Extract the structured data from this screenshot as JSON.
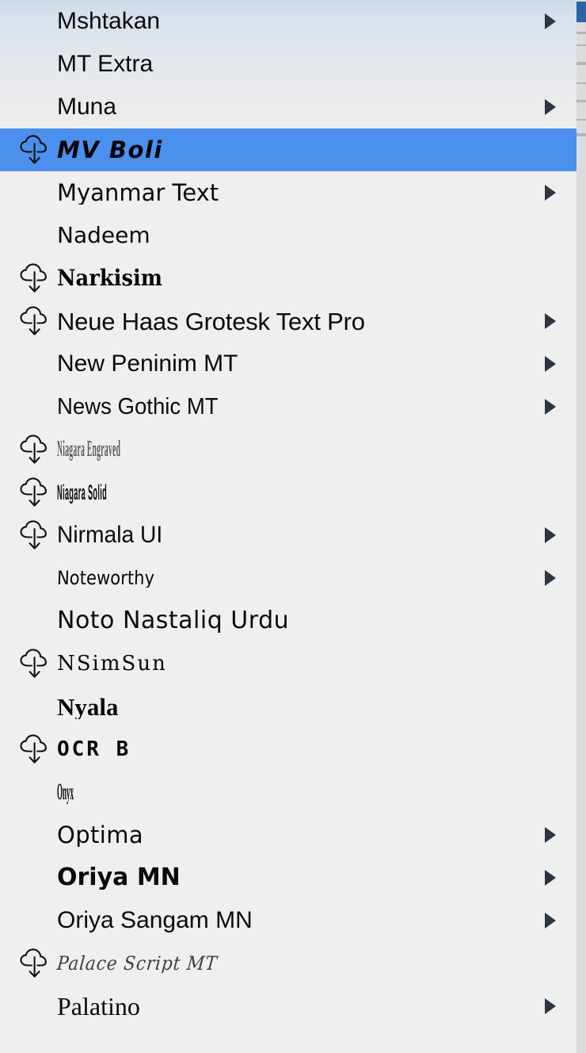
{
  "menu": {
    "kind": "font-family-picker-dropdown",
    "selected_item": "MV Boli",
    "colors": {
      "selection_blue": "#4a90ec",
      "panel_background": "#efefef",
      "panel_gradient_top": "#ccd9e8",
      "arrow": "#2d3541",
      "label_text": "#0a0a0a"
    },
    "items": [
      {
        "label": "Mshtakan",
        "style": "fs-sans",
        "downloadable": false,
        "has_submenu": true,
        "selected": false
      },
      {
        "label": "MT Extra",
        "style": "fs-sans",
        "downloadable": false,
        "has_submenu": false,
        "selected": false
      },
      {
        "label": "Muna",
        "style": "fs-muna",
        "downloadable": false,
        "has_submenu": true,
        "selected": false
      },
      {
        "label": "MV Boli",
        "style": "fs-mvboli",
        "downloadable": true,
        "has_submenu": false,
        "selected": true
      },
      {
        "label": "Myanmar Text",
        "style": "fs-myanmar",
        "downloadable": false,
        "has_submenu": true,
        "selected": false
      },
      {
        "label": "Nadeem",
        "style": "fs-nadeem",
        "downloadable": false,
        "has_submenu": false,
        "selected": false
      },
      {
        "label": "Narkisim",
        "style": "fs-narkisim",
        "downloadable": true,
        "has_submenu": false,
        "selected": false
      },
      {
        "label": "Neue Haas Grotesk Text Pro",
        "style": "fs-neuehaas",
        "downloadable": true,
        "has_submenu": true,
        "selected": false
      },
      {
        "label": "New Peninim MT",
        "style": "fs-sans",
        "downloadable": false,
        "has_submenu": true,
        "selected": false
      },
      {
        "label": "News Gothic MT",
        "style": "fs-newsgothic",
        "downloadable": false,
        "has_submenu": true,
        "selected": false
      },
      {
        "label": "Niagara Engraved",
        "style": "fs-niagara-engraved",
        "downloadable": true,
        "has_submenu": false,
        "selected": false
      },
      {
        "label": "Niagara Solid",
        "style": "fs-niagara",
        "downloadable": true,
        "has_submenu": false,
        "selected": false
      },
      {
        "label": "Nirmala UI",
        "style": "fs-nirmala",
        "downloadable": true,
        "has_submenu": true,
        "selected": false
      },
      {
        "label": "Noteworthy",
        "style": "fs-noteworthy",
        "downloadable": false,
        "has_submenu": true,
        "selected": false
      },
      {
        "label": "Noto Nastaliq Urdu",
        "style": "fs-noto",
        "downloadable": false,
        "has_submenu": false,
        "selected": false
      },
      {
        "label": "NSimSun",
        "style": "fs-nsimsun",
        "downloadable": true,
        "has_submenu": false,
        "selected": false
      },
      {
        "label": "Nyala",
        "style": "fs-nyala",
        "downloadable": false,
        "has_submenu": false,
        "selected": false
      },
      {
        "label": "OCR B",
        "style": "fs-ocrb",
        "downloadable": true,
        "has_submenu": false,
        "selected": false
      },
      {
        "label": "Onyx",
        "style": "fs-onyx",
        "downloadable": false,
        "has_submenu": false,
        "selected": false
      },
      {
        "label": "Optima",
        "style": "fs-optima",
        "downloadable": false,
        "has_submenu": true,
        "selected": false
      },
      {
        "label": "Oriya MN",
        "style": "fs-oriyamn",
        "downloadable": false,
        "has_submenu": true,
        "selected": false
      },
      {
        "label": "Oriya Sangam MN",
        "style": "fs-sans-lt",
        "downloadable": false,
        "has_submenu": true,
        "selected": false
      },
      {
        "label": "Palace Script MT",
        "style": "fs-palace",
        "downloadable": true,
        "has_submenu": false,
        "selected": false
      },
      {
        "label": "Palatino",
        "style": "fs-palatino",
        "downloadable": false,
        "has_submenu": true,
        "selected": false
      }
    ]
  }
}
